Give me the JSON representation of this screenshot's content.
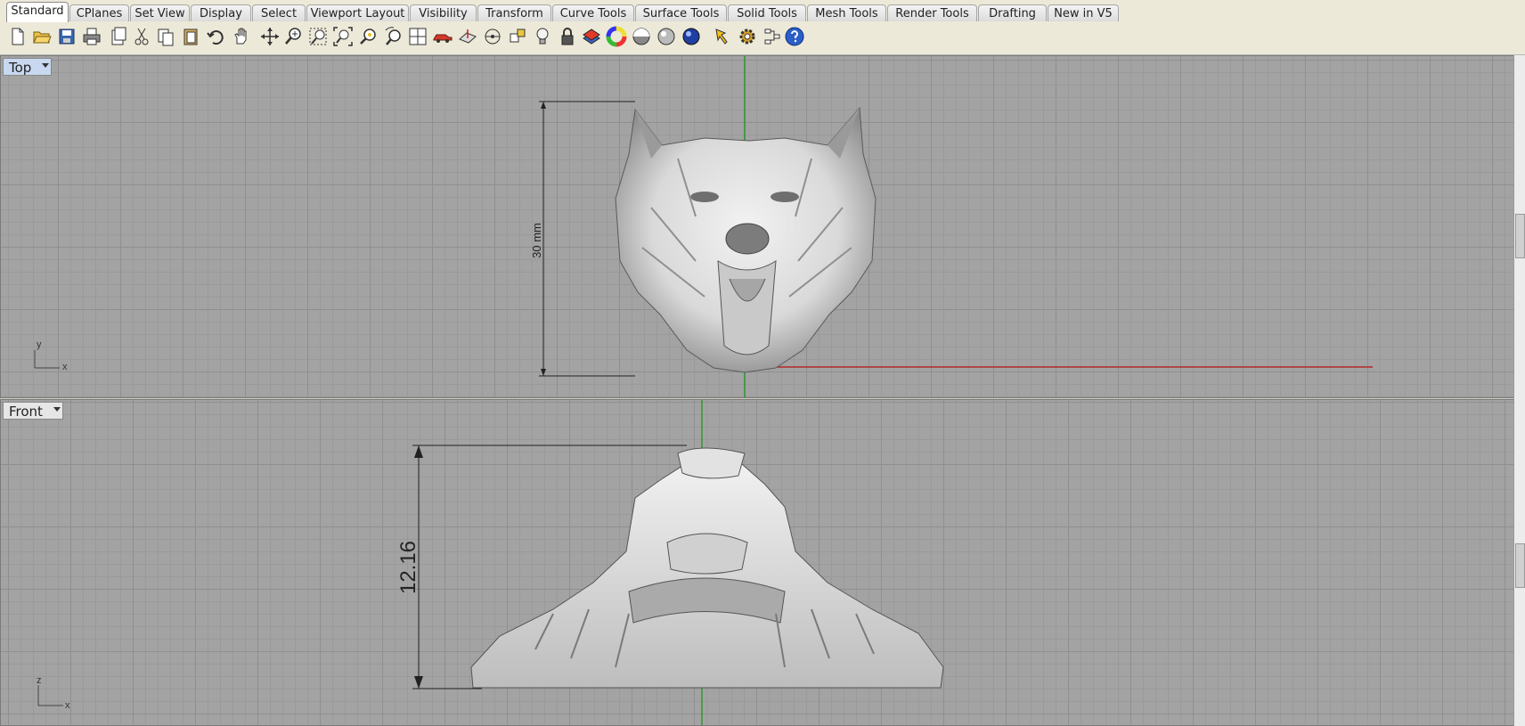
{
  "tabs": [
    {
      "label": "Standard",
      "active": true
    },
    {
      "label": "CPlanes"
    },
    {
      "label": "Set View"
    },
    {
      "label": "Display"
    },
    {
      "label": "Select"
    },
    {
      "label": "Viewport Layout"
    },
    {
      "label": "Visibility"
    },
    {
      "label": "Transform"
    },
    {
      "label": "Curve Tools"
    },
    {
      "label": "Surface Tools"
    },
    {
      "label": "Solid Tools"
    },
    {
      "label": "Mesh Tools"
    },
    {
      "label": "Render Tools"
    },
    {
      "label": "Drafting"
    },
    {
      "label": "New in V5"
    }
  ],
  "toolbar_icons": [
    "new-document-icon",
    "open-folder-icon",
    "save-icon",
    "print-icon",
    "import-icon",
    "cut-icon",
    "copy-icon",
    "paste-icon",
    "undo-icon",
    "pan-hand-icon",
    "rotate-view-icon",
    "zoom-dynamic-icon",
    "zoom-window-icon",
    "zoom-extents-icon",
    "zoom-selected-icon",
    "undo-view-icon",
    "four-viewports-icon",
    "car-model-icon",
    "cplane-icon",
    "point-snap-icon",
    "gumball-icon",
    "light-bulb-icon",
    "lock-icon",
    "layer-icon",
    "color-wheel-icon",
    "shaded-sphere-icon",
    "rendered-sphere-icon",
    "render-sphere-icon",
    "highlight-icon",
    "options-gear-icon",
    "properties-icon",
    "help-icon"
  ],
  "viewports": {
    "top": {
      "label": "Top",
      "axis_x": "x",
      "axis_y": "y",
      "dimension": "30 mm"
    },
    "front": {
      "label": "Front",
      "axis_x": "x",
      "axis_y": "z",
      "dimension": "12.16"
    }
  },
  "colors": {
    "viewport_bg": "#a3a3a3",
    "x_axis": "#b22a2a",
    "y_axis": "#2e9a2e",
    "active_label": "#c8d8f0"
  }
}
